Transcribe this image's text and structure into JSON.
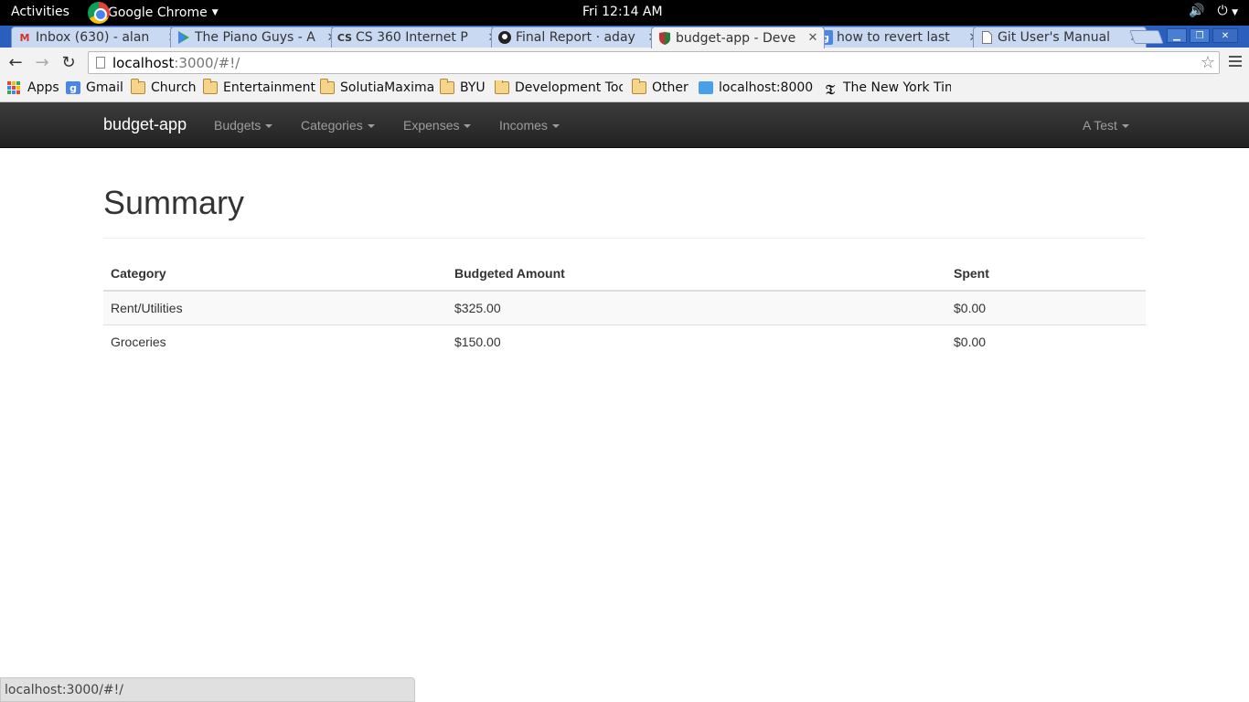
{
  "system_bar": {
    "activities": "Activities",
    "app_name": "Google Chrome",
    "clock": "Fri 12:14 AM"
  },
  "tabs": [
    {
      "title": "Inbox (630) - alan",
      "icon": "gmail-icon"
    },
    {
      "title": "The Piano Guys - A",
      "icon": "play-store-icon"
    },
    {
      "title": "CS 360 Internet P",
      "icon": "cs-icon",
      "icon_text": "CS"
    },
    {
      "title": "Final Report · aday",
      "icon": "github-icon"
    },
    {
      "title": "budget-app - Deve",
      "icon": "shield-icon",
      "active": true
    },
    {
      "title": "how to revert last",
      "icon": "google-icon",
      "icon_text": "g"
    },
    {
      "title": "Git User's Manual",
      "icon": "page-icon"
    }
  ],
  "address_bar": {
    "host": "localhost",
    "path": ":3000/#!/"
  },
  "bookmarks": [
    {
      "label": "Apps",
      "icon": "apps-grid-icon"
    },
    {
      "label": "Gmail",
      "icon": "google-icon"
    },
    {
      "label": "Church",
      "icon": "folder-icon"
    },
    {
      "label": "Entertainment",
      "icon": "folder-icon"
    },
    {
      "label": "SolutiaMaxima",
      "icon": "folder-icon"
    },
    {
      "label": "BYU",
      "icon": "folder-icon"
    },
    {
      "label": "Development Too",
      "icon": "folder-icon"
    },
    {
      "label": "Other",
      "icon": "folder-icon"
    },
    {
      "label": "localhost:8000",
      "icon": "localhost-icon"
    },
    {
      "label": "The New York Tim",
      "icon": "nyt-icon"
    }
  ],
  "navbar": {
    "brand": "budget-app",
    "menus": [
      "Budgets",
      "Categories",
      "Expenses",
      "Incomes"
    ],
    "user": "A Test"
  },
  "main": {
    "title": "Summary",
    "table": {
      "headers": [
        "Category",
        "Budgeted Amount",
        "Spent"
      ],
      "rows": [
        [
          "Rent/Utilities",
          "$325.00",
          "$0.00"
        ],
        [
          "Groceries",
          "$150.00",
          "$0.00"
        ]
      ]
    }
  },
  "status_url": "localhost:3000/#!/"
}
